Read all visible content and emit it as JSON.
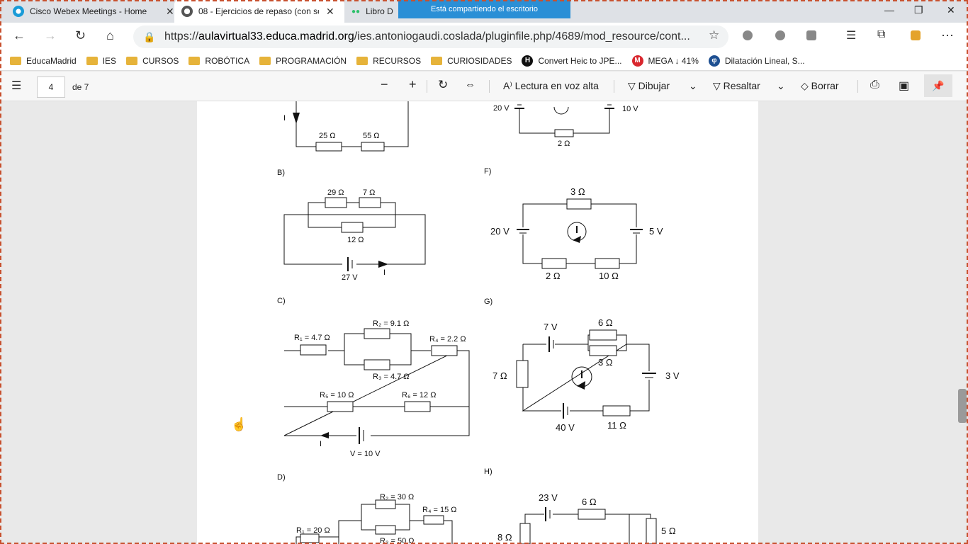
{
  "tabs": [
    {
      "title": "Cisco Webex Meetings - Home"
    },
    {
      "title": "08 - Ejercicios de repaso (con sol"
    },
    {
      "title": "Libro D"
    }
  ],
  "share_banner": "Está compartiendo el escritorio",
  "address": {
    "url_prefix": "https://",
    "host": "aulavirtual33.educa.madrid.org",
    "path": "/ies.antoniogaudi.coslada/pluginfile.php/4689/mod_resource/cont..."
  },
  "bookmarks": [
    {
      "label": "EducaMadrid",
      "icon": "folder-icon"
    },
    {
      "label": "IES",
      "icon": "folder-icon"
    },
    {
      "label": "CURSOS",
      "icon": "folder-icon"
    },
    {
      "label": "ROBÓTICA",
      "icon": "folder-icon"
    },
    {
      "label": "PROGRAMACIÓN",
      "icon": "folder-icon"
    },
    {
      "label": "RECURSOS",
      "icon": "folder-icon"
    },
    {
      "label": "CURIOSIDADES",
      "icon": "folder-icon"
    },
    {
      "label": "Convert Heic to JPE...",
      "icon": "heic-icon"
    },
    {
      "label": "MEGA ↓ 41%",
      "icon": "mega-icon"
    },
    {
      "label": "Dilatación Lineal, S...",
      "icon": "dilatacion-icon"
    }
  ],
  "pdf_toolbar": {
    "page": "4",
    "of": "de 7",
    "read_aloud": "Lectura en voz alta",
    "draw": "Dibujar",
    "highlight": "Resaltar",
    "erase": "Borrar"
  },
  "doc": {
    "labels": {
      "B": "B)",
      "C": "C)",
      "D": "D)",
      "F": "F)",
      "G": "G)",
      "H": "H)",
      "I": "I"
    },
    "circA": {
      "r1": "25 Ω",
      "r2": "55 Ω"
    },
    "circB": {
      "r1": "29 Ω",
      "r2": "7 Ω",
      "r3": "12 Ω",
      "v": "27 V"
    },
    "circC": {
      "r1": "R₁ = 4.7 Ω",
      "r2": "R₂ = 9.1 Ω",
      "r3": "R₃ = 4.7 Ω",
      "r4": "R₄ = 2.2 Ω",
      "r5": "R₅ = 10 Ω",
      "r6": "R₆ = 12 Ω",
      "v": "V = 10 V"
    },
    "circD": {
      "r1": "R₁ = 20 Ω",
      "r2": "R₂ = 30 Ω",
      "r3": "R₃ = 50 Ω",
      "r4": "R₄ = 15 Ω"
    },
    "circE": {
      "v1": "20 V",
      "v2": "10 V",
      "r": "2 Ω"
    },
    "circF": {
      "r1": "3 Ω",
      "v1": "20 V",
      "v2": "5 V",
      "r2": "2 Ω",
      "r3": "10 Ω"
    },
    "circG": {
      "v1": "7 V",
      "r1": "6 Ω",
      "r2": "3 Ω",
      "r3": "7 Ω",
      "v2": "3 V",
      "v3": "40 V",
      "r4": "11 Ω"
    },
    "circH": {
      "v1": "23 V",
      "r1": "6 Ω",
      "r2": "8 Ω",
      "r3": "5 Ω"
    }
  }
}
